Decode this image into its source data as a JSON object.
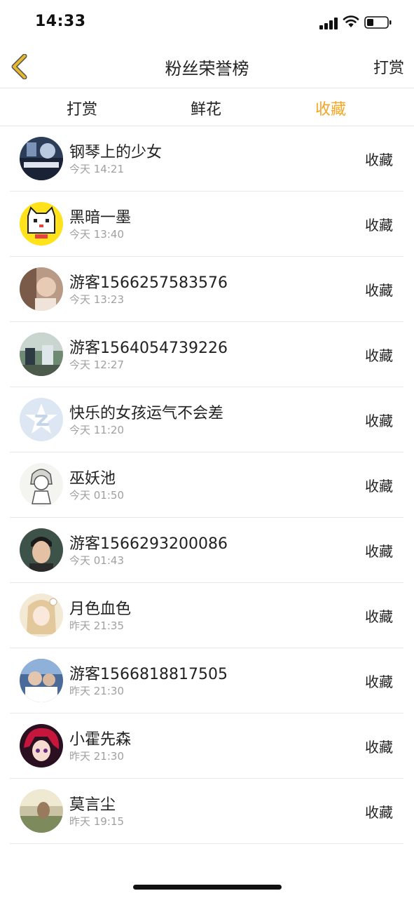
{
  "status_bar": {
    "time": "14:33"
  },
  "nav": {
    "back_icon": "chevron-left-icon",
    "title": "粉丝荣誉榜",
    "right_label": "打赏"
  },
  "tabs": [
    {
      "label": "打赏",
      "active": false
    },
    {
      "label": "鲜花",
      "active": false
    },
    {
      "label": "收藏",
      "active": true
    }
  ],
  "colors": {
    "accent": "#f5a623",
    "back_icon_fill": "#e8b92a",
    "back_icon_stroke": "#555555",
    "subtext": "#a0a0a0",
    "divider": "#e8e8e8"
  },
  "list": [
    {
      "name": "钢琴上的少女",
      "time": "今天 14:21",
      "action": "收藏"
    },
    {
      "name": "黑暗一墨",
      "time": "今天 13:40",
      "action": "收藏"
    },
    {
      "name": "游客1566257583576",
      "time": "今天 13:23",
      "action": "收藏"
    },
    {
      "name": "游客1564054739226",
      "time": "今天 12:27",
      "action": "收藏"
    },
    {
      "name": "快乐的女孩运气不会差",
      "time": "今天 11:20",
      "action": "收藏"
    },
    {
      "name": "巫妖池",
      "time": "今天 01:50",
      "action": "收藏"
    },
    {
      "name": "游客1566293200086",
      "time": "今天 01:43",
      "action": "收藏"
    },
    {
      "name": "月色血色",
      "time": "昨天 21:35",
      "action": "收藏"
    },
    {
      "name": "游客1566818817505",
      "time": "昨天 21:30",
      "action": "收藏"
    },
    {
      "name": "小霍先森",
      "time": "昨天 21:30",
      "action": "收藏"
    },
    {
      "name": "莫言尘",
      "time": "昨天 19:15",
      "action": "收藏"
    }
  ]
}
